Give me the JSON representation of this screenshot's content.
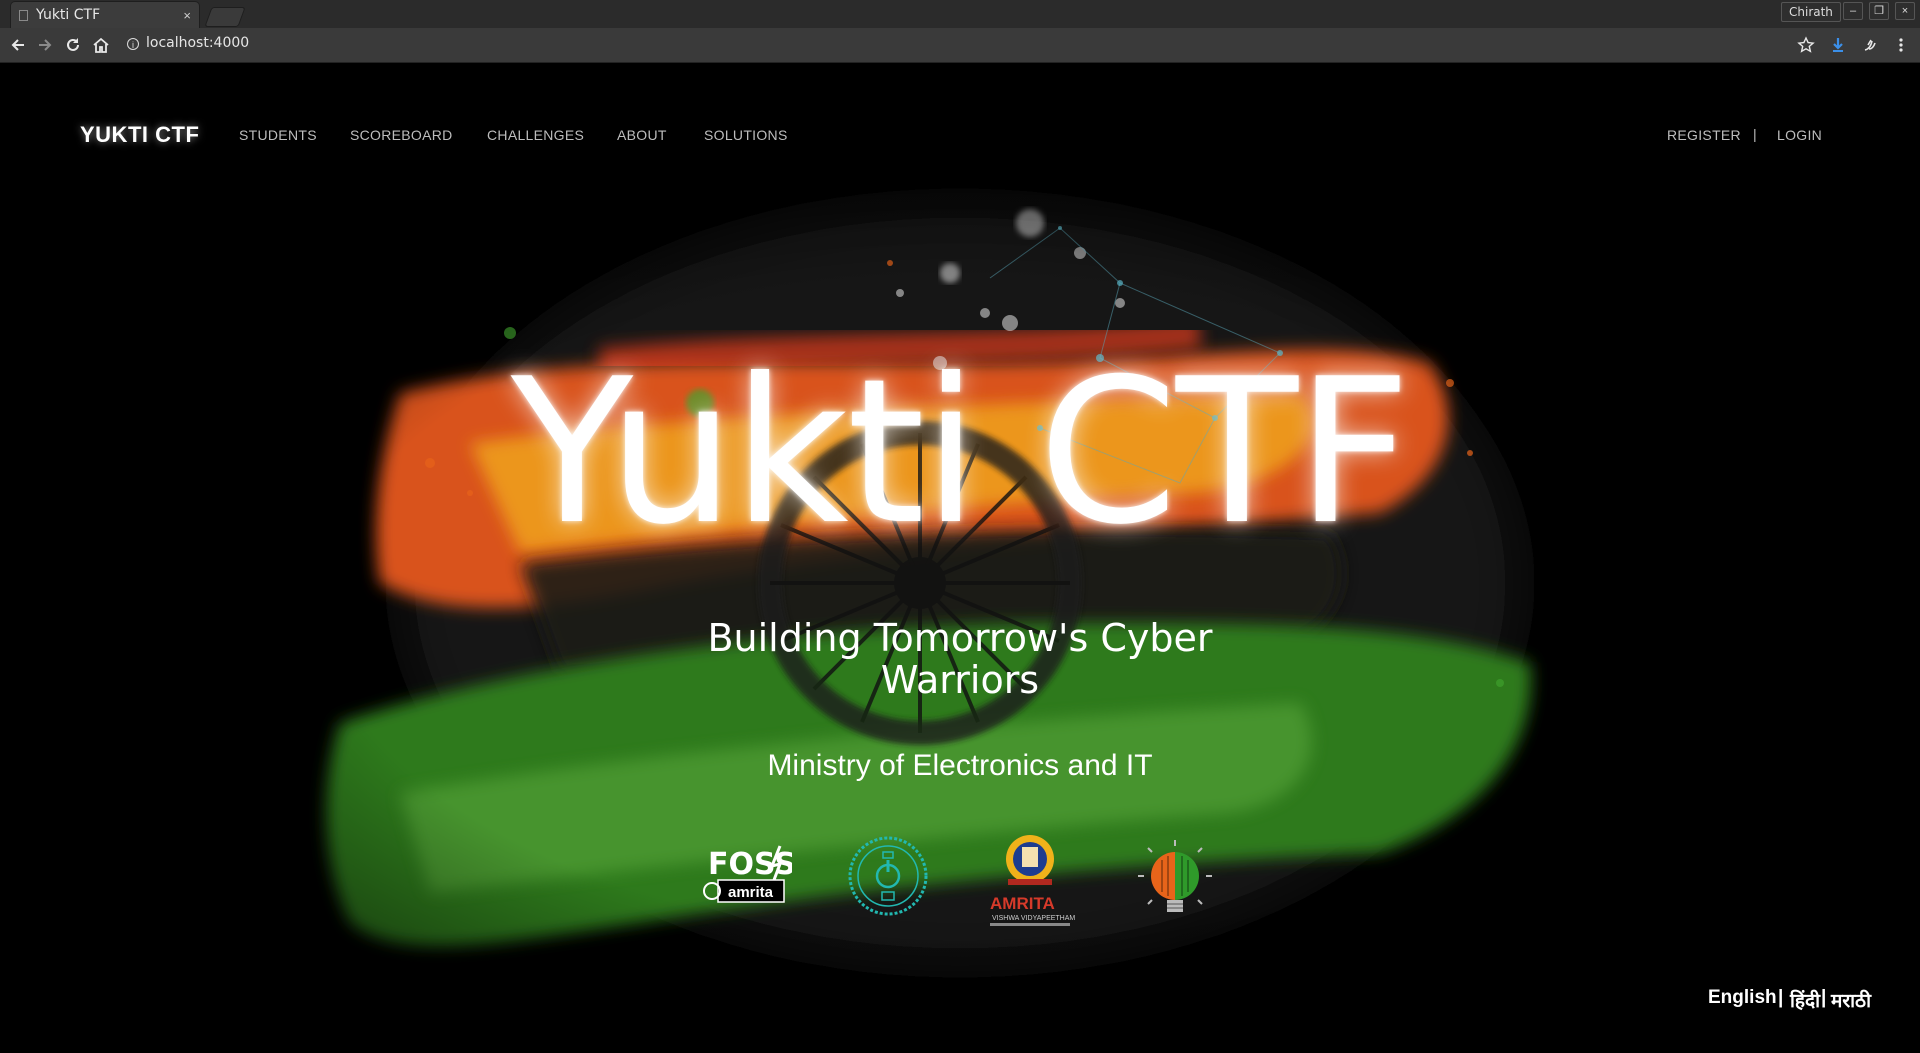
{
  "browser": {
    "tab_title": "Yukti CTF",
    "tab_close": "×",
    "profile": "Chirath",
    "address": "localhost:4000",
    "win_min": "–",
    "win_restore": "❐",
    "win_close": "×"
  },
  "nav": {
    "brand": "YUKTI CTF",
    "items": [
      "STUDENTS",
      "SCOREBOARD",
      "CHALLENGES",
      "ABOUT",
      "SOLUTIONS"
    ],
    "register": "REGISTER",
    "separator": "|",
    "login": "LOGIN"
  },
  "hero": {
    "title": "Yukti CTF",
    "subtitle": "Building Tomorrow's Cyber Warriors",
    "ministry": "Ministry of Electronics and IT"
  },
  "logos": {
    "foss_text": "FOSS",
    "foss_sub": "amrita",
    "amrita_name": "AMRITA",
    "amrita_sub": "VISHWA VIDYAPEETHAM"
  },
  "languages": {
    "english": "English",
    "hindi": "हिंदी",
    "marathi": "मराठी",
    "separator": "|"
  },
  "colors": {
    "saffron": "#e8641a",
    "green": "#2f7a1e",
    "chakra": "#1b1b1b",
    "background": "#000000"
  }
}
